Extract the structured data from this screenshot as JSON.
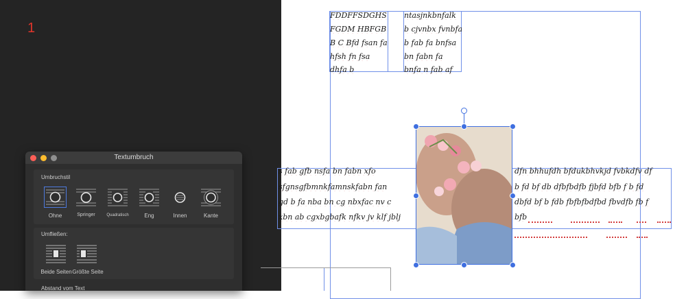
{
  "page": {
    "number": "1"
  },
  "panel": {
    "title": "Textumbruch",
    "wrap_section_label": "Umbruchstil",
    "wrap_styles": [
      {
        "label": "Ohne",
        "icon": "wrap-none-icon",
        "selected": true
      },
      {
        "label": "Springer",
        "icon": "wrap-jump-icon",
        "selected": false
      },
      {
        "label": "Quadratisch",
        "icon": "wrap-square-icon",
        "selected": false
      },
      {
        "label": "Eng",
        "icon": "wrap-tight-icon",
        "selected": false
      },
      {
        "label": "Innen",
        "icon": "wrap-inside-icon",
        "selected": false
      },
      {
        "label": "Kante",
        "icon": "wrap-edge-icon",
        "selected": false
      }
    ],
    "flow_section_label": "Umfließen:",
    "flow_options": [
      {
        "label": "Beide Seiten",
        "icon": "flow-both-sides-icon"
      },
      {
        "label": "Größte Seite",
        "icon": "flow-largest-side-icon"
      }
    ],
    "spacing_label": "Abstand vom Text"
  },
  "text_block_top": {
    "col1": [
      "FDDFFSDGHS",
      "FGDM HBFGB",
      "B C Bfd fsan fa",
      "hfsh fn fsa",
      "dhfa b"
    ],
    "col2": [
      "ntasjnkbnfalk",
      "b cjvnbx fvnbfa",
      "b fab fa bnfsa",
      "bn fabn fa",
      "bnfa n fab af"
    ]
  },
  "text_block_wrap": {
    "left_lines": [
      "s fab gfb nsfa bn fabn xfo",
      "sfgnsgfbmnkfamnskfabn fan",
      "gd b fa nba bn cg nbxfac nv c",
      "xbn ab cgxbgbafk nfkv jv klf jblj"
    ],
    "right_lines": [
      "dfn bhhufdh bfdukbhvkjd fvbkdfv df",
      "b fd bf db dfbfbdfb fjbfd bfb f b fd",
      "dbfd bf b fdb fbfbfbdfbd fbvdfb fb f",
      "bfb"
    ]
  },
  "colors": {
    "frame": "#6f8fe8",
    "handle": "#3f6fe0",
    "spell_error": "#d23b3b",
    "page_number": "#e0352b",
    "selection": "#4e7be0"
  }
}
